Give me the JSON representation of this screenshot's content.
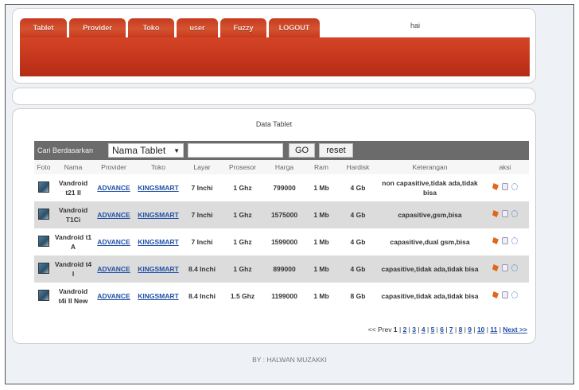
{
  "nav": {
    "tabs": [
      "Tablet",
      "Provider",
      "Toko",
      "user",
      "Fuzzy",
      "LOGOUT"
    ],
    "greeting": "hai"
  },
  "panel": {
    "title": "Data Tablet",
    "search": {
      "label": "Cari Berdasarkan",
      "select_value": "Nama Tablet",
      "go_label": "GO",
      "reset_label": "reset"
    }
  },
  "table": {
    "headers": [
      "Foto",
      "Nama",
      "Provider",
      "Toko",
      "Layar",
      "Prosesor",
      "Harga",
      "Ram",
      "Hardisk",
      "Keterangan",
      "aksi"
    ],
    "rows": [
      {
        "nama": "Vandroid t21 II",
        "provider": "ADVANCE",
        "toko": "KINGSMART",
        "layar": "7 Inchi",
        "prosesor": "1 Ghz",
        "harga": "799000",
        "ram": "1 Mb",
        "hardisk": "4 Gb",
        "keterangan": "non capasitive,tidak ada,tidak bisa"
      },
      {
        "nama": "Vandroid T1Ci",
        "provider": "ADVANCE",
        "toko": "KINGSMART",
        "layar": "7 Inchi",
        "prosesor": "1 Ghz",
        "harga": "1575000",
        "ram": "1 Mb",
        "hardisk": "4 Gb",
        "keterangan": "capasitive,gsm,bisa"
      },
      {
        "nama": "Vandroid t1 A",
        "provider": "ADVANCE",
        "toko": "KINGSMART",
        "layar": "7 Inchi",
        "prosesor": "1 Ghz",
        "harga": "1599000",
        "ram": "1 Mb",
        "hardisk": "4 Gb",
        "keterangan": "capasitive,dual gsm,bisa"
      },
      {
        "nama": "Vandroid t4 I",
        "provider": "ADVANCE",
        "toko": "KINGSMART",
        "layar": "8.4 Inchi",
        "prosesor": "1 Ghz",
        "harga": "899000",
        "ram": "1 Mb",
        "hardisk": "4 Gb",
        "keterangan": "capasitive,tidak ada,tidak bisa"
      },
      {
        "nama": "Vandroid t4i II New",
        "provider": "ADVANCE",
        "toko": "KINGSMART",
        "layar": "8.4 Inchi",
        "prosesor": "1.5 Ghz",
        "harga": "1199000",
        "ram": "1 Mb",
        "hardisk": "8 Gb",
        "keterangan": "capasitive,tidak ada,tidak bisa"
      }
    ]
  },
  "pagination": {
    "prev": "<< Prev",
    "current": "1",
    "pages": [
      "2",
      "3",
      "4",
      "5",
      "6",
      "7",
      "8",
      "9",
      "10",
      "11"
    ],
    "next": "Next >>"
  },
  "footer": {
    "credit": "BY : HALWAN MUZAKKI"
  }
}
